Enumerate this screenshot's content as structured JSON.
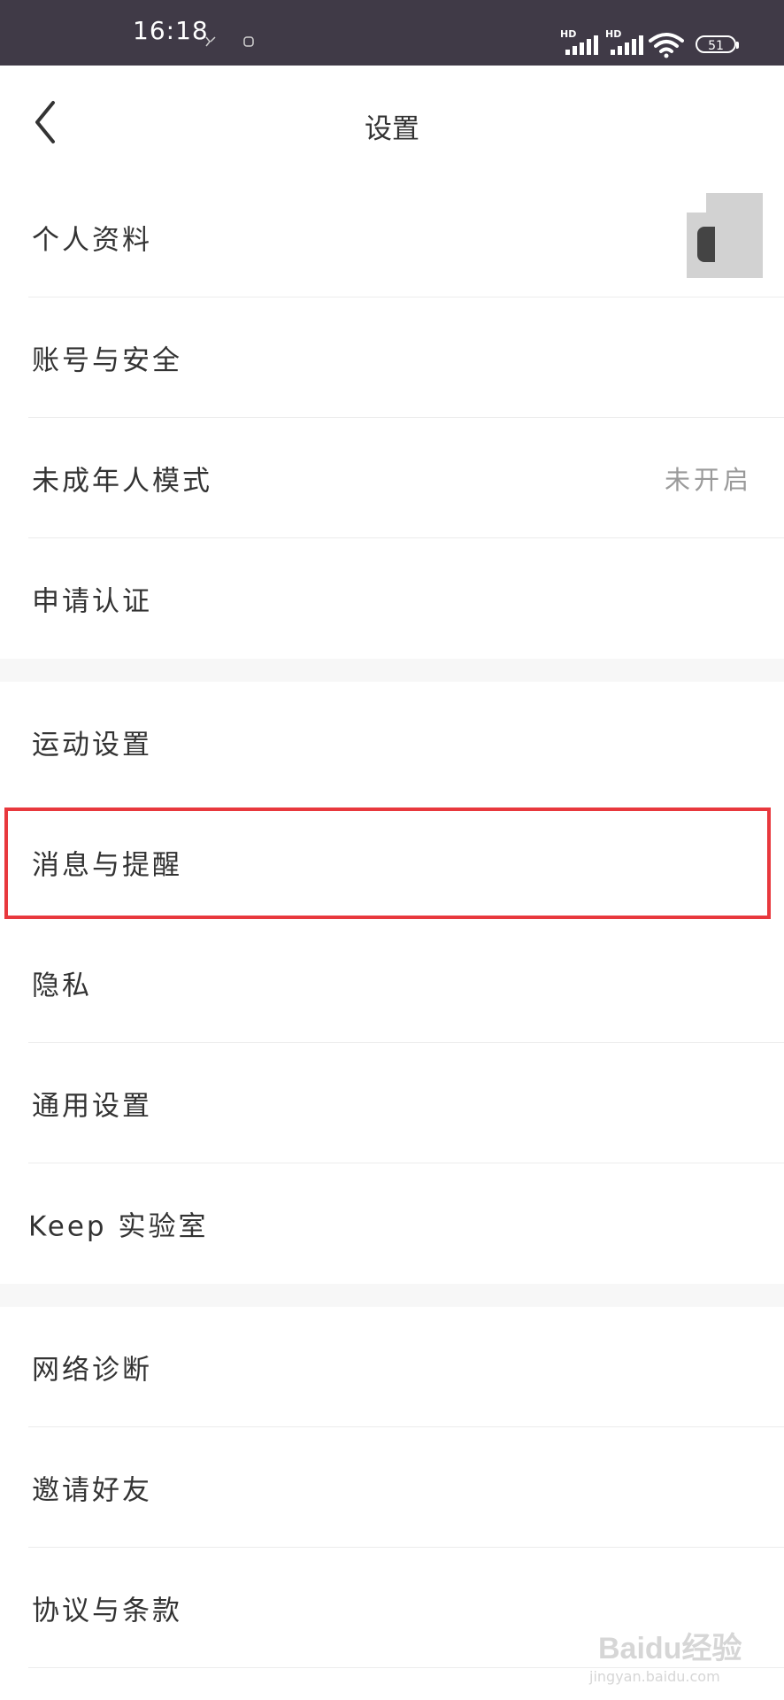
{
  "status_bar": {
    "time": "16:18",
    "battery_level": "51",
    "icons": [
      "hd-signal-icon",
      "hd-signal-icon",
      "wifi-icon",
      "battery-icon"
    ]
  },
  "header": {
    "title": "设置",
    "back_icon": "chevron-left-icon"
  },
  "sections": [
    {
      "items": [
        {
          "label": "个人资料",
          "value": "",
          "trailing": "avatar"
        },
        {
          "label": "账号与安全",
          "value": ""
        },
        {
          "label": "未成年人模式",
          "value": "未开启"
        },
        {
          "label": "申请认证",
          "value": ""
        }
      ]
    },
    {
      "items": [
        {
          "label": "运动设置",
          "value": ""
        },
        {
          "label": "消息与提醒",
          "value": "",
          "highlighted": true
        },
        {
          "label": "隐私",
          "value": ""
        },
        {
          "label": "通用设置",
          "value": ""
        },
        {
          "label": "Keep 实验室",
          "value": ""
        }
      ]
    },
    {
      "items": [
        {
          "label": "网络诊断",
          "value": ""
        },
        {
          "label": "邀请好友",
          "value": ""
        },
        {
          "label": "协议与条款",
          "value": ""
        }
      ]
    }
  ],
  "colors": {
    "status_bar_bg": "#403a47",
    "highlight_border": "#e8383d",
    "section_gap": "#f7f7f7",
    "text_primary": "#333333",
    "text_secondary": "#9a9a9a"
  },
  "watermark": {
    "text": "Baidu经验",
    "sub": "jingyan.baidu.com"
  }
}
